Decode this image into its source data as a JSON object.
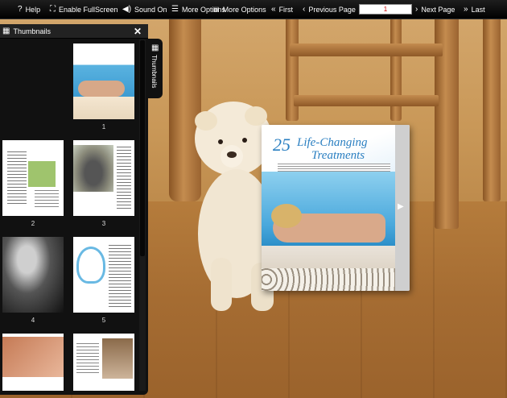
{
  "toolbar": {
    "help": "Help",
    "fullscreen": "Enable FullScreen",
    "sound": "Sound On",
    "more_options_1": "More Options",
    "more_options_2": "More Options",
    "first": "First",
    "previous": "Previous Page",
    "page_value": "1",
    "next": "Next Page",
    "last": "Last"
  },
  "panel": {
    "title": "Thumbnails",
    "tab_label": "Thumbnails",
    "pages": [
      "1",
      "2",
      "3",
      "4",
      "5"
    ]
  },
  "book": {
    "title_number": "25",
    "title_line1": "Life-Changing",
    "title_line2": "Treatments"
  },
  "colors": {
    "toolbar_bg": "#000000",
    "panel_bg": "#111111",
    "page_input_text": "#cc0000",
    "title_color": "#2a7fc1"
  }
}
